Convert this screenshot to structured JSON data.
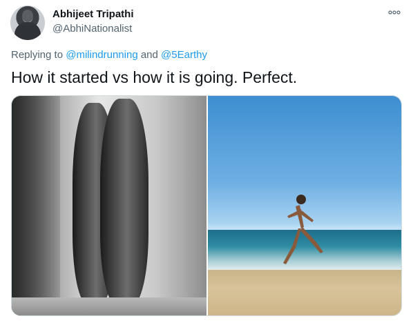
{
  "user": {
    "name": "Abhijeet Tripathi",
    "handle": "@AbhiNationalist"
  },
  "more_icon": "more-options-icon",
  "reply": {
    "prefix": "Replying to",
    "mention1": "@milindrunning",
    "conjunction": "and",
    "mention2": "@5Earthy"
  },
  "tweet": {
    "text": "How it started vs how it is going. Perfect."
  },
  "colors": {
    "text": "#0f1419",
    "secondary": "#536471",
    "link": "#1d9bf0",
    "border": "#cfd9de"
  }
}
